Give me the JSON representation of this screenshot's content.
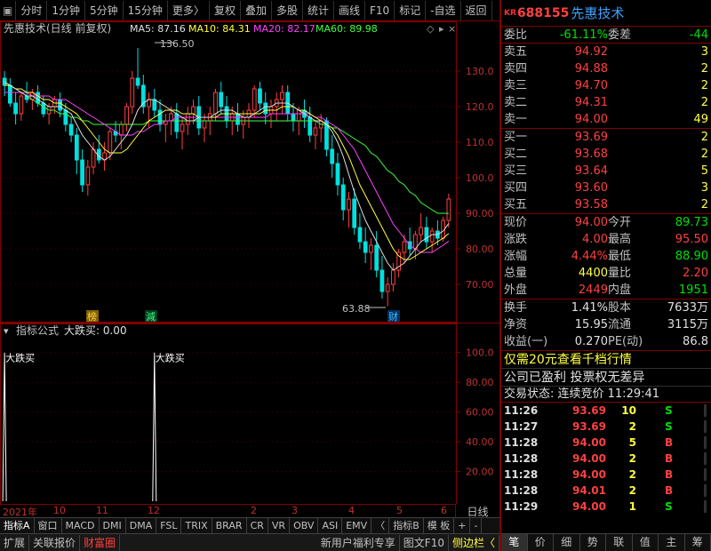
{
  "toolbar": {
    "items": [
      "分时",
      "1分钟",
      "5分钟",
      "15分钟",
      "更多〉",
      "复权",
      "叠加",
      "多股",
      "统计",
      "画线",
      "F10",
      "标记",
      "-自选",
      "返回"
    ]
  },
  "main_chart": {
    "title": "先惠技术(日线 前复权)",
    "ma_labels": [
      {
        "text": "MA5: 87.16",
        "color": "#e0e0e0"
      },
      {
        "text": "MA10: 84.31",
        "color": "#ffff40"
      },
      {
        "text": "MA20: 82.17",
        "color": "#ff40ff"
      },
      {
        "text": "MA60: 89.98",
        "color": "#40ff40"
      }
    ],
    "y_ticks": [
      "130.0",
      "120.0",
      "110.0",
      "100.0",
      "90.00",
      "80.00",
      "70.00"
    ],
    "high_label": "136.50",
    "low_label": "63.88",
    "marker_bang": "榜",
    "marker_jian": "減",
    "marker_cai": "财"
  },
  "indicator": {
    "title": "指标公式",
    "name_value": "大跌买: 0.00",
    "y_ticks": [
      "100.0",
      "80.00",
      "60.00",
      "40.00",
      "20.00"
    ],
    "signal_label": "大跌买"
  },
  "time_axis": {
    "labels": [
      "2021年",
      "10",
      "11",
      "12",
      "2",
      "3",
      "4",
      "5",
      "6"
    ],
    "period": "日线"
  },
  "indicator_tabs": [
    "指标A",
    "窗口",
    "MACD",
    "DMI",
    "DMA",
    "FSL",
    "TRIX",
    "BRAR",
    "CR",
    "VR",
    "OBV",
    "ASI",
    "EMV",
    "〈",
    "指标B",
    "模 板",
    "+",
    "-"
  ],
  "bottom_bar": {
    "left": [
      "扩展",
      "关联报价",
      "财富圈"
    ],
    "right": [
      "新用户福利专享",
      "图文F10",
      "侧边栏〈"
    ]
  },
  "quote": {
    "kr": "KR",
    "code": "688155",
    "name": "先惠技术",
    "weibi_label": "委比",
    "weibi": "-61.11%",
    "weicha_label": "委差",
    "weicha": "-44",
    "asks": [
      {
        "label": "卖五",
        "price": "94.92",
        "vol": "3"
      },
      {
        "label": "卖四",
        "price": "94.88",
        "vol": "2"
      },
      {
        "label": "卖三",
        "price": "94.70",
        "vol": "2"
      },
      {
        "label": "卖二",
        "price": "94.31",
        "vol": "2"
      },
      {
        "label": "卖一",
        "price": "94.00",
        "vol": "49"
      }
    ],
    "bids": [
      {
        "label": "买一",
        "price": "93.69",
        "vol": "2"
      },
      {
        "label": "买二",
        "price": "93.68",
        "vol": "2"
      },
      {
        "label": "买三",
        "price": "93.64",
        "vol": "5"
      },
      {
        "label": "买四",
        "price": "93.60",
        "vol": "3"
      },
      {
        "label": "买五",
        "price": "93.58",
        "vol": "2"
      }
    ],
    "stats": [
      {
        "l1": "现价",
        "v1": "94.00",
        "c1": "red",
        "l2": "今开",
        "v2": "89.73",
        "c2": "green"
      },
      {
        "l1": "涨跌",
        "v1": "4.00",
        "c1": "red",
        "l2": "最高",
        "v2": "95.50",
        "c2": "red"
      },
      {
        "l1": "涨幅",
        "v1": "4.44%",
        "c1": "red",
        "l2": "最低",
        "v2": "88.90",
        "c2": "green"
      },
      {
        "l1": "总量",
        "v1": "4400",
        "c1": "yellow",
        "l2": "量比",
        "v2": "2.20",
        "c2": "red"
      },
      {
        "l1": "外盘",
        "v1": "2449",
        "c1": "red",
        "l2": "内盘",
        "v2": "1951",
        "c2": "green"
      }
    ],
    "stats2": [
      {
        "l1": "换手",
        "v1": "1.41%",
        "l2": "股本",
        "v2": "7633万"
      },
      {
        "l1": "净资",
        "v1": "15.95",
        "l2": "流通",
        "v2": "3115万"
      },
      {
        "l1": "收益(一)",
        "v1": "0.270",
        "l2": "PE(动)",
        "v2": "86.8"
      }
    ],
    "ad_text": "仅需20元查看千档行情",
    "ad_text2": "公司已盈利 投票权无差异",
    "status_text": "交易状态: 连续竞价 11:29:41",
    "trades": [
      {
        "time": "11:26",
        "price": "93.69",
        "vol": "10",
        "side": "S"
      },
      {
        "time": "11:27",
        "price": "93.69",
        "vol": "2",
        "side": "S"
      },
      {
        "time": "11:28",
        "price": "94.00",
        "vol": "5",
        "side": "B"
      },
      {
        "time": "11:28",
        "price": "94.00",
        "vol": "2",
        "side": "B"
      },
      {
        "time": "11:28",
        "price": "94.00",
        "vol": "2",
        "side": "B"
      },
      {
        "time": "11:28",
        "price": "94.01",
        "vol": "2",
        "side": "B"
      },
      {
        "time": "11:29",
        "price": "94.00",
        "vol": "1",
        "side": "S"
      }
    ],
    "tabs": [
      "笔",
      "价",
      "细",
      "势",
      "联",
      "值",
      "主",
      "筹"
    ]
  },
  "colors": {
    "up": "#ff4040",
    "down": "#00e0e0",
    "ma5": "#e0e0e0",
    "ma10": "#ffff40",
    "ma20": "#ff40ff",
    "ma60": "#40ff40",
    "frame": "#800000"
  },
  "chart_data": {
    "type": "candlestick",
    "y_range": [
      60,
      140
    ],
    "candles": [
      [
        128,
        130,
        123,
        126
      ],
      [
        126,
        128,
        120,
        121
      ],
      [
        121,
        124,
        115,
        118
      ],
      [
        118,
        124,
        116,
        123
      ],
      [
        123,
        127,
        121,
        122
      ],
      [
        122,
        125,
        119,
        124
      ],
      [
        124,
        126,
        120,
        121
      ],
      [
        121,
        123,
        117,
        118
      ],
      [
        118,
        121,
        115,
        120
      ],
      [
        120,
        123,
        118,
        122
      ],
      [
        122,
        124,
        117,
        119
      ],
      [
        119,
        121,
        113,
        115
      ],
      [
        115,
        117,
        110,
        112
      ],
      [
        112,
        114,
        101,
        105
      ],
      [
        105,
        108,
        96,
        98
      ],
      [
        98,
        105,
        95,
        103
      ],
      [
        103,
        110,
        101,
        108
      ],
      [
        108,
        112,
        104,
        105
      ],
      [
        105,
        110,
        102,
        107
      ],
      [
        107,
        114,
        105,
        113
      ],
      [
        113,
        116,
        110,
        112
      ],
      [
        112,
        116,
        108,
        115
      ],
      [
        115,
        121,
        113,
        120
      ],
      [
        120,
        130,
        118,
        128
      ],
      [
        128,
        136.5,
        125,
        126
      ],
      [
        126,
        129,
        118,
        120
      ],
      [
        120,
        124,
        114,
        122
      ],
      [
        122,
        125,
        117,
        119
      ],
      [
        119,
        122,
        113,
        115
      ],
      [
        115,
        118,
        110,
        116
      ],
      [
        116,
        120,
        112,
        118
      ],
      [
        118,
        121,
        111,
        113
      ],
      [
        113,
        117,
        108,
        115
      ],
      [
        115,
        120,
        112,
        118
      ],
      [
        118,
        122,
        115,
        120
      ],
      [
        120,
        123,
        112,
        114
      ],
      [
        114,
        118,
        110,
        116
      ],
      [
        116,
        120,
        112,
        118
      ],
      [
        118,
        125,
        116,
        124
      ],
      [
        124,
        127,
        118,
        120
      ],
      [
        120,
        123,
        114,
        116
      ],
      [
        116,
        120,
        112,
        118
      ],
      [
        118,
        121,
        113,
        115
      ],
      [
        115,
        119,
        111,
        117
      ],
      [
        117,
        121,
        114,
        119
      ],
      [
        119,
        126,
        117,
        125
      ],
      [
        125,
        127,
        119,
        121
      ],
      [
        121,
        124,
        115,
        118
      ],
      [
        118,
        122,
        114,
        120
      ],
      [
        120,
        124,
        116,
        122
      ],
      [
        122,
        126,
        118,
        124
      ],
      [
        124,
        126,
        116,
        118
      ],
      [
        118,
        121,
        113,
        116
      ],
      [
        116,
        120,
        112,
        119
      ],
      [
        119,
        122,
        114,
        117
      ],
      [
        117,
        120,
        110,
        112
      ],
      [
        112,
        116,
        108,
        114
      ],
      [
        114,
        118,
        110,
        116
      ],
      [
        116,
        117,
        106,
        108
      ],
      [
        108,
        112,
        100,
        104
      ],
      [
        104,
        107,
        95,
        98
      ],
      [
        98,
        100,
        88,
        91
      ],
      [
        91,
        96,
        86,
        94
      ],
      [
        94,
        97,
        84,
        86
      ],
      [
        86,
        90,
        80,
        82
      ],
      [
        82,
        86,
        76,
        79
      ],
      [
        79,
        83,
        74,
        81
      ],
      [
        81,
        85,
        72,
        74
      ],
      [
        74,
        78,
        66,
        68
      ],
      [
        68,
        72,
        63.88,
        70
      ],
      [
        70,
        76,
        68,
        74
      ],
      [
        74,
        80,
        72,
        79
      ],
      [
        79,
        84,
        76,
        82
      ],
      [
        82,
        86,
        78,
        80
      ],
      [
        80,
        85,
        77,
        84
      ],
      [
        84,
        90,
        82,
        86
      ],
      [
        86,
        89,
        80,
        82
      ],
      [
        82,
        86,
        79,
        85
      ],
      [
        85,
        88,
        81,
        83
      ],
      [
        83,
        89,
        82,
        88
      ],
      [
        88,
        95.5,
        86,
        94
      ]
    ],
    "ma5": [
      127,
      126,
      125,
      124,
      123,
      123,
      122,
      121,
      120,
      120,
      120,
      119,
      118,
      115,
      112,
      110,
      108,
      106,
      105,
      106,
      108,
      110,
      112,
      115,
      119,
      121,
      122,
      122,
      121,
      120,
      119,
      118,
      117,
      116,
      116,
      117,
      117,
      117,
      118,
      119,
      119,
      119,
      118,
      117,
      117,
      118,
      119,
      120,
      120,
      121,
      121,
      121,
      120,
      119,
      118,
      117,
      116,
      116,
      115,
      113,
      110,
      106,
      101,
      96,
      92,
      88,
      85,
      82,
      79,
      76,
      74,
      75,
      76,
      78,
      80,
      82,
      83,
      84,
      84,
      85,
      87.16
    ],
    "ma10": [
      126,
      126,
      125,
      125,
      124,
      124,
      123,
      122,
      122,
      121,
      121,
      120,
      119,
      118,
      116,
      114,
      112,
      110,
      108,
      107,
      107,
      107,
      108,
      110,
      112,
      114,
      116,
      117,
      118,
      119,
      119,
      119,
      118,
      118,
      118,
      117,
      117,
      117,
      117,
      118,
      118,
      118,
      118,
      118,
      118,
      118,
      118,
      119,
      119,
      119,
      120,
      120,
      120,
      119,
      119,
      118,
      117,
      116,
      115,
      114,
      112,
      109,
      106,
      102,
      98,
      95,
      92,
      89,
      86,
      83,
      80,
      78,
      77,
      77,
      78,
      79,
      80,
      81,
      82,
      83,
      84.31
    ],
    "ma20": [
      124,
      124,
      124,
      124,
      124,
      123,
      123,
      123,
      123,
      122,
      122,
      122,
      121,
      120,
      119,
      118,
      117,
      116,
      115,
      114,
      113,
      112,
      112,
      112,
      113,
      113,
      114,
      115,
      115,
      116,
      116,
      117,
      117,
      117,
      117,
      117,
      117,
      117,
      117,
      117,
      117,
      117,
      117,
      117,
      117,
      117,
      117,
      117,
      118,
      118,
      118,
      118,
      118,
      118,
      118,
      118,
      117,
      117,
      116,
      115,
      114,
      112,
      110,
      108,
      105,
      102,
      99,
      96,
      93,
      90,
      87,
      85,
      83,
      81,
      80,
      79,
      79,
      79,
      80,
      81,
      82.17
    ],
    "ma60": [
      127,
      126,
      125,
      124,
      123,
      122,
      121,
      120,
      119,
      119,
      118,
      118,
      117,
      117,
      116,
      116,
      115,
      115,
      115,
      115,
      115,
      115,
      115,
      115,
      115,
      115,
      116,
      116,
      116,
      116,
      116,
      116,
      116,
      116,
      116,
      116,
      116,
      116,
      116,
      116,
      116,
      116,
      116,
      116,
      116,
      116,
      116,
      116,
      116,
      116,
      116,
      116,
      116,
      116,
      116,
      116,
      116,
      115,
      115,
      114,
      114,
      113,
      112,
      111,
      110,
      109,
      107,
      106,
      104,
      102,
      101,
      99,
      98,
      96,
      95,
      93,
      92,
      91,
      90,
      90,
      89.98
    ],
    "indicator_spikes": [
      0,
      27,
      97,
      109
    ],
    "indicator_range": [
      0,
      110
    ]
  }
}
